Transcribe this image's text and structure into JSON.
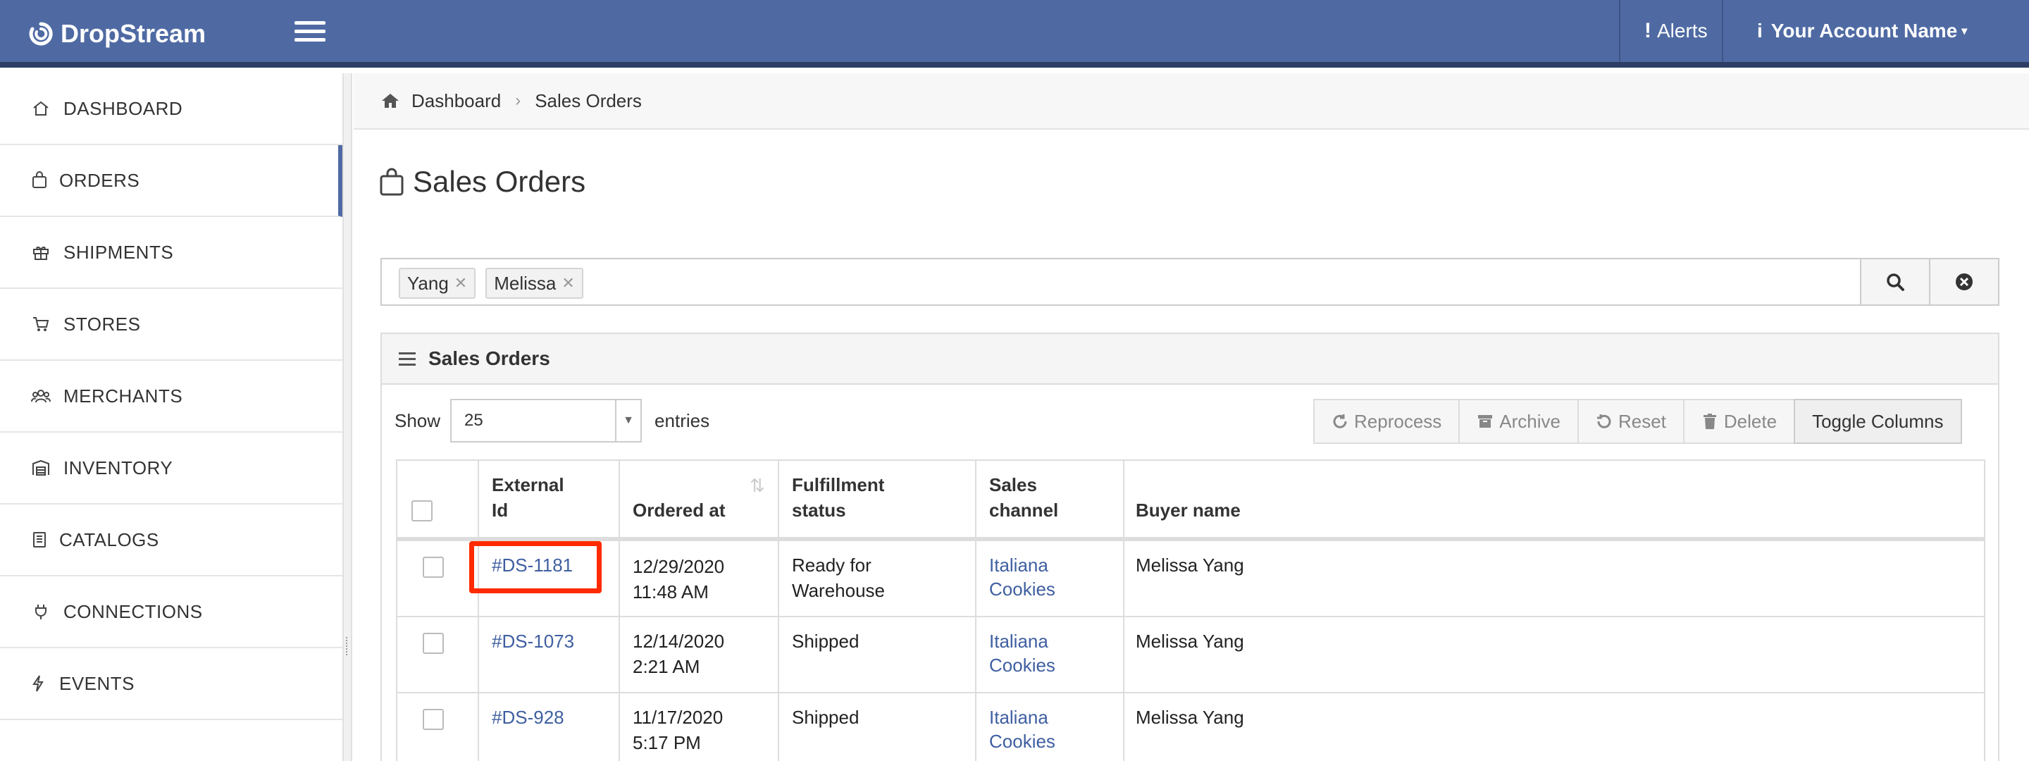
{
  "app": {
    "brand": "DropStream",
    "alerts_label": "Alerts",
    "account_label": "Your Account Name"
  },
  "colors": {
    "topbar": "#4f6aa3",
    "link": "#3f5fa0",
    "highlight": "#ff2a00"
  },
  "sidebar": {
    "items": [
      {
        "label": "DASHBOARD",
        "icon": "home-icon"
      },
      {
        "label": "ORDERS",
        "icon": "shopping-bag-icon"
      },
      {
        "label": "SHIPMENTS",
        "icon": "gift-box-icon"
      },
      {
        "label": "STORES",
        "icon": "cart-icon"
      },
      {
        "label": "MERCHANTS",
        "icon": "users-icon"
      },
      {
        "label": "INVENTORY",
        "icon": "warehouse-icon"
      },
      {
        "label": "CATALOGS",
        "icon": "book-icon"
      },
      {
        "label": "CONNECTIONS",
        "icon": "plug-icon"
      },
      {
        "label": "EVENTS",
        "icon": "bolt-icon"
      }
    ]
  },
  "breadcrumb": {
    "home": "Dashboard",
    "current": "Sales Orders"
  },
  "page": {
    "title": "Sales Orders"
  },
  "search": {
    "tags": [
      "Yang",
      "Melissa"
    ]
  },
  "panel": {
    "title": "Sales Orders",
    "show_label": "Show",
    "entries_value": "25",
    "entries_label": "entries",
    "buttons": [
      "Reprocess",
      "Archive",
      "Reset",
      "Delete",
      "Toggle Columns"
    ]
  },
  "table": {
    "headers": {
      "external_id_1": "External",
      "external_id_2": "Id",
      "ordered_at": "Ordered at",
      "fulfillment_1": "Fulfillment",
      "fulfillment_2": "status",
      "channel_1": "Sales",
      "channel_2": "channel",
      "buyer": "Buyer name"
    },
    "rows": [
      {
        "id": "#DS-1181",
        "date": "12/29/2020",
        "time": "11:48 AM",
        "status1": "Ready for",
        "status2": "Warehouse",
        "channel1": "Italiana",
        "channel2": "Cookies",
        "buyer": "Melissa Yang"
      },
      {
        "id": "#DS-1073",
        "date": "12/14/2020",
        "time": "2:21 AM",
        "status1": "Shipped",
        "status2": "",
        "channel1": "Italiana",
        "channel2": "Cookies",
        "buyer": "Melissa Yang"
      },
      {
        "id": "#DS-928",
        "date": "11/17/2020",
        "time": "5:17 PM",
        "status1": "Shipped",
        "status2": "",
        "channel1": "Italiana",
        "channel2": "Cookies",
        "buyer": "Melissa Yang"
      }
    ]
  }
}
